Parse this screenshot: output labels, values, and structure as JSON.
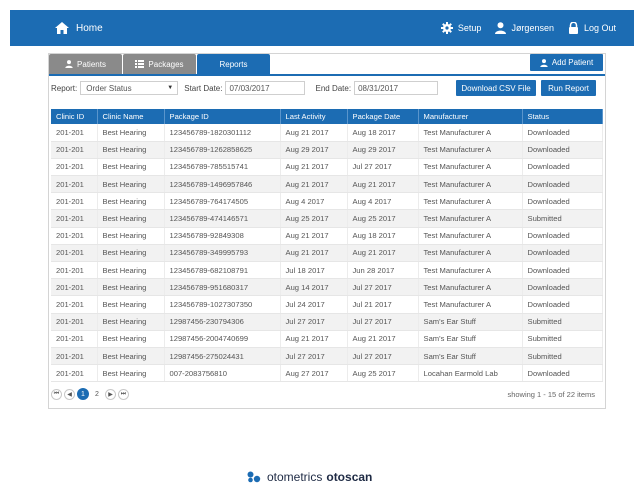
{
  "topbar": {
    "home_label": "Home",
    "setup_label": "Setup",
    "user_label": "Jørgensen",
    "logout_label": "Log Out"
  },
  "tabs": [
    {
      "label": "Patients",
      "icon": "user-icon"
    },
    {
      "label": "Packages",
      "icon": "list-icon"
    },
    {
      "label": "Reports",
      "active": true
    }
  ],
  "add_patient_label": "Add Patient",
  "filters": {
    "report_label": "Report:",
    "report_value": "Order Status",
    "start_label": "Start Date:",
    "start_value": "07/03/2017",
    "end_label": "End Date:",
    "end_value": "08/31/2017",
    "download_label": "Download CSV File",
    "run_label": "Run Report"
  },
  "table": {
    "headers": [
      "Clinic ID",
      "Clinic Name",
      "Package ID",
      "Last Activity",
      "Package Date",
      "Manufacturer",
      "Status"
    ],
    "rows": [
      [
        "201-201",
        "Best Hearing",
        "123456789-1820301112",
        "Aug 21 2017",
        "Aug 18 2017",
        "Test Manufacturer A",
        "Downloaded"
      ],
      [
        "201-201",
        "Best Hearing",
        "123456789-1262858625",
        "Aug 29 2017",
        "Aug 29 2017",
        "Test Manufacturer A",
        "Downloaded"
      ],
      [
        "201-201",
        "Best Hearing",
        "123456789-785515741",
        "Aug 21 2017",
        "Jul 27 2017",
        "Test Manufacturer A",
        "Downloaded"
      ],
      [
        "201-201",
        "Best Hearing",
        "123456789-1496957846",
        "Aug 21 2017",
        "Aug 21 2017",
        "Test Manufacturer A",
        "Downloaded"
      ],
      [
        "201-201",
        "Best Hearing",
        "123456789-764174505",
        "Aug 4 2017",
        "Aug 4 2017",
        "Test Manufacturer A",
        "Downloaded"
      ],
      [
        "201-201",
        "Best Hearing",
        "123456789-474146571",
        "Aug 25 2017",
        "Aug 25 2017",
        "Test Manufacturer A",
        "Submitted"
      ],
      [
        "201-201",
        "Best Hearing",
        "123456789-92849308",
        "Aug 21 2017",
        "Aug 18 2017",
        "Test Manufacturer A",
        "Downloaded"
      ],
      [
        "201-201",
        "Best Hearing",
        "123456789-349995793",
        "Aug 21 2017",
        "Aug 21 2017",
        "Test Manufacturer A",
        "Downloaded"
      ],
      [
        "201-201",
        "Best Hearing",
        "123456789-682108791",
        "Jul 18 2017",
        "Jun 28 2017",
        "Test Manufacturer A",
        "Downloaded"
      ],
      [
        "201-201",
        "Best Hearing",
        "123456789-951680317",
        "Aug 14 2017",
        "Jul 27 2017",
        "Test Manufacturer A",
        "Downloaded"
      ],
      [
        "201-201",
        "Best Hearing",
        "123456789-1027307350",
        "Jul 24 2017",
        "Jul 21 2017",
        "Test Manufacturer A",
        "Downloaded"
      ],
      [
        "201-201",
        "Best Hearing",
        "12987456-230794306",
        "Jul 27 2017",
        "Jul 27 2017",
        "Sam's Ear Stuff",
        "Submitted"
      ],
      [
        "201-201",
        "Best Hearing",
        "12987456-2004740699",
        "Aug 21 2017",
        "Aug 21 2017",
        "Sam's Ear Stuff",
        "Submitted"
      ],
      [
        "201-201",
        "Best Hearing",
        "12987456-275024431",
        "Jul 27 2017",
        "Jul 27 2017",
        "Sam's Ear Stuff",
        "Submitted"
      ],
      [
        "201-201",
        "Best Hearing",
        "007-2083756810",
        "Aug 27 2017",
        "Aug 25 2017",
        "Locahan Earmold Lab",
        "Downloaded"
      ]
    ]
  },
  "pager": {
    "first": "⏮",
    "prev": "◀",
    "pages": [
      "1",
      "2"
    ],
    "current": "1",
    "next": "▶",
    "last": "⏭",
    "info": "showing 1 - 15 of 22 items"
  },
  "brand": {
    "name_part1": "otometrics",
    "name_part2": "otoscan"
  },
  "colors": {
    "primary": "#1c6cb3",
    "tab_inactive": "#8a8a8a"
  }
}
